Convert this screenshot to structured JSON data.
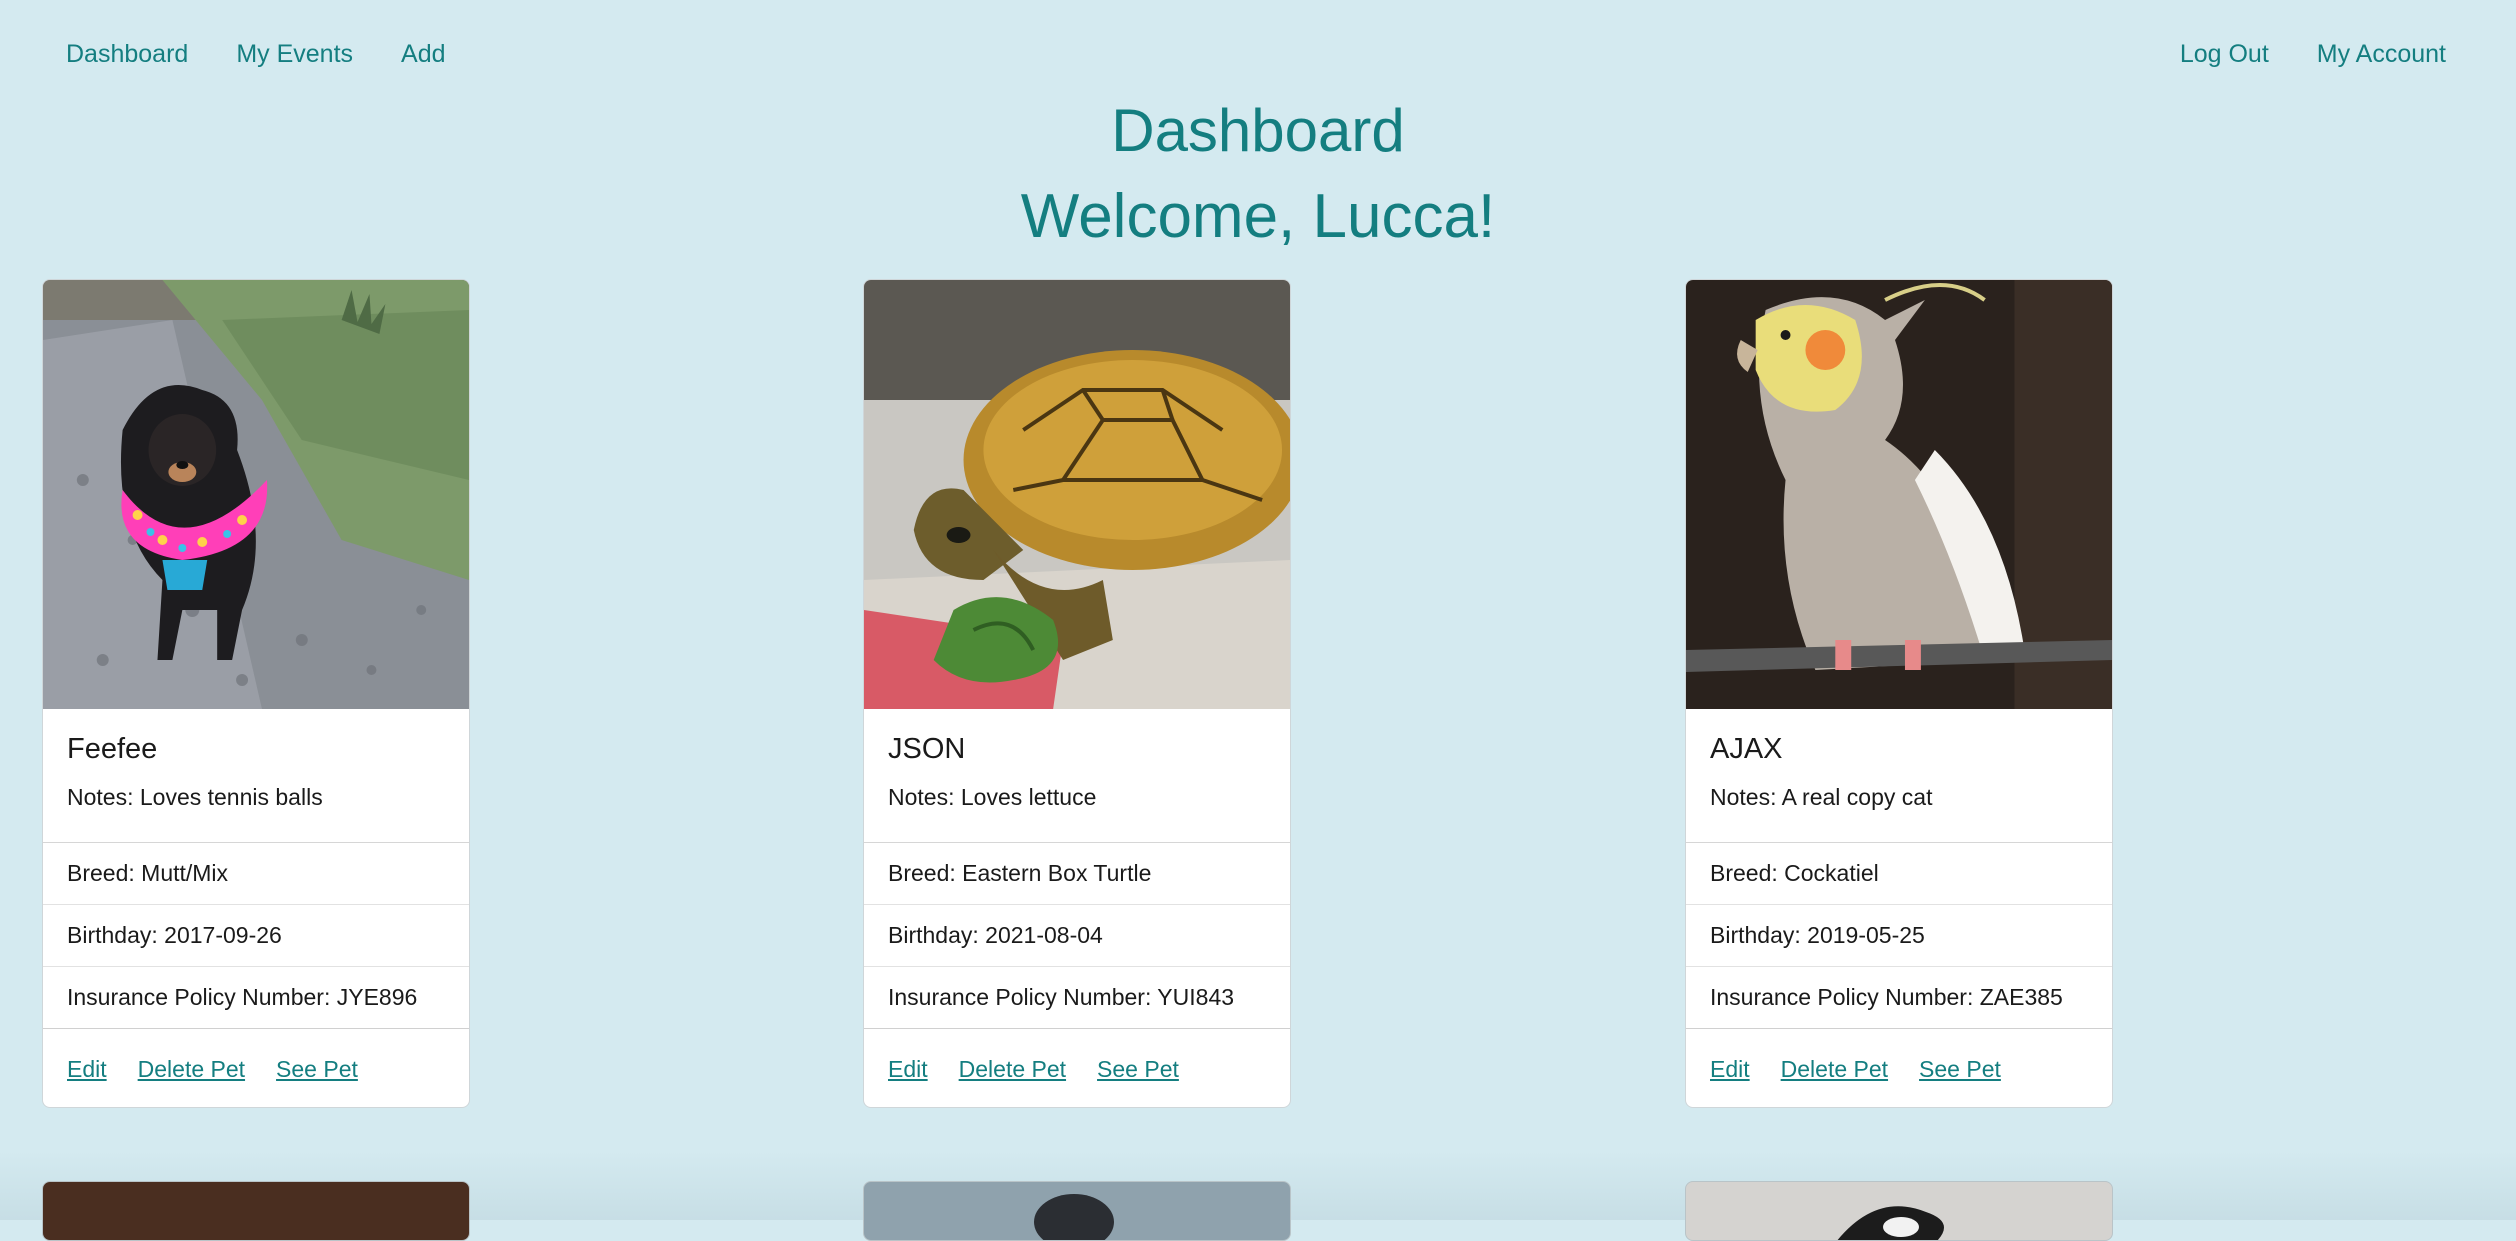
{
  "nav": {
    "left": [
      "Dashboard",
      "My Events",
      "Add"
    ],
    "right": [
      "Log Out",
      "My Account"
    ]
  },
  "page": {
    "title": "Dashboard",
    "welcome": "Welcome, Lucca!"
  },
  "pets": [
    {
      "name": "Feefee",
      "notes": "Notes: Loves tennis balls",
      "breed": "Breed: Mutt/Mix",
      "birthday": "Birthday: 2017-09-26",
      "insurance": "Insurance Policy Number: JYE896",
      "photo": "dog-photo"
    },
    {
      "name": "JSON",
      "notes": "Notes: Loves lettuce",
      "breed": "Breed: Eastern Box Turtle",
      "birthday": "Birthday: 2021-08-04",
      "insurance": "Insurance Policy Number: YUI843",
      "photo": "turtle-photo"
    },
    {
      "name": "AJAX",
      "notes": "Notes: A real copy cat",
      "breed": "Breed: Cockatiel",
      "birthday": "Birthday: 2019-05-25",
      "insurance": "Insurance Policy Number: ZAE385",
      "photo": "cockatiel-photo"
    }
  ],
  "card_links": {
    "edit": "Edit",
    "delete": "Delete Pet",
    "see": "See Pet"
  },
  "colors": {
    "background": "#d4eaf0",
    "accent": "#147e80"
  }
}
